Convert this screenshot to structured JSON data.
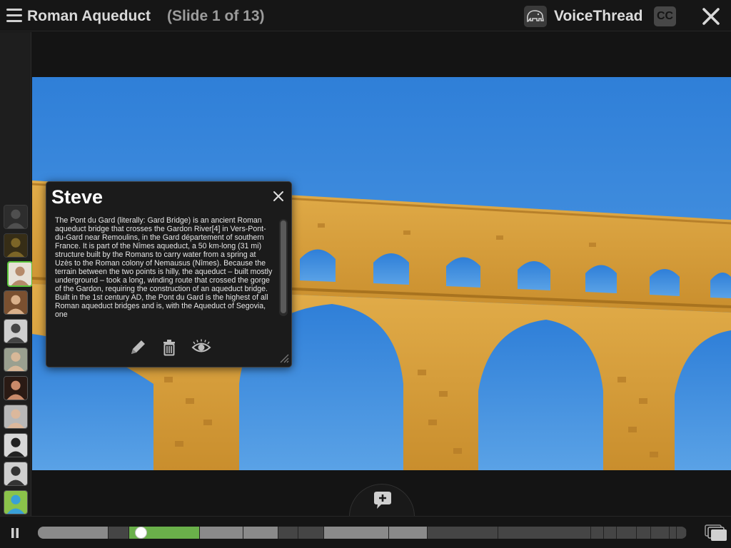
{
  "header": {
    "title": "Roman Aqueduct",
    "slide_count": "(Slide 1 of 13)",
    "brand": "VoiceThread",
    "cc_label": "CC"
  },
  "sidebar": {
    "avatars": [
      {
        "label": "commenter-1",
        "state": "dim"
      },
      {
        "label": "commenter-2",
        "state": "dim"
      },
      {
        "label": "Steve",
        "state": "active"
      },
      {
        "label": "commenter-4",
        "state": "normal"
      },
      {
        "label": "commenter-5",
        "state": "normal"
      },
      {
        "label": "commenter-6",
        "state": "normal"
      },
      {
        "label": "commenter-7",
        "state": "normal"
      },
      {
        "label": "commenter-8",
        "state": "normal"
      },
      {
        "label": "commenter-9",
        "state": "normal"
      },
      {
        "label": "commenter-10",
        "state": "normal"
      },
      {
        "label": "commenter-11",
        "state": "normal"
      }
    ]
  },
  "comment": {
    "author": "Steve",
    "text": "The Pont du Gard (literally: Gard Bridge) is an ancient Roman aqueduct bridge that crosses the Gardon River[4] in Vers-Pont-du-Gard near Remoulins, in the Gard département of southern France. It is part of the Nîmes aqueduct, a 50 km-long (31 mi) structure built by the Romans to carry water from a spring at Uzès to the Roman colony of Nemausus (Nîmes). Because the terrain between the two points is hilly, the aqueduct – built mostly underground – took a long, winding route that crossed the gorge of the Gardon, requiring the construction of an aqueduct bridge. Built in the 1st century AD, the Pont du Gard is the highest of all Roman aqueduct bridges and is, with the Aqueduct of Segovia, one"
  },
  "colors": {
    "accent_green": "#6ab04a",
    "sky": "#3b86d6",
    "stone": "#d9a542"
  },
  "icons": [
    "menu-icon",
    "voicethread-logo-icon",
    "close-icon",
    "pencil-icon",
    "trash-icon",
    "eye-icon",
    "resize-icon",
    "add-comment-icon",
    "pause-icon",
    "slides-icon"
  ]
}
